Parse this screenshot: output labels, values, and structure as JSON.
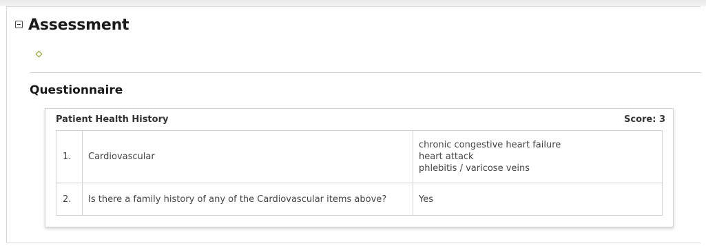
{
  "section": {
    "title": "Assessment"
  },
  "questionnaire": {
    "title": "Questionnaire",
    "card": {
      "title": "Patient Health History",
      "score_label": "Score: 3",
      "rows": [
        {
          "number": "1.",
          "question": "Cardiovascular",
          "answers": [
            "chronic congestive heart failure",
            "heart attack",
            "phlebitis / varicose veins"
          ]
        },
        {
          "number": "2.",
          "question": "Is there a family history of any of the Cardiovascular items above?",
          "answers": [
            "Yes"
          ]
        }
      ]
    }
  },
  "icons": {
    "collapse": "collapse-minus-icon",
    "status": "diamond-icon",
    "status_color": "#8a9a1e"
  }
}
